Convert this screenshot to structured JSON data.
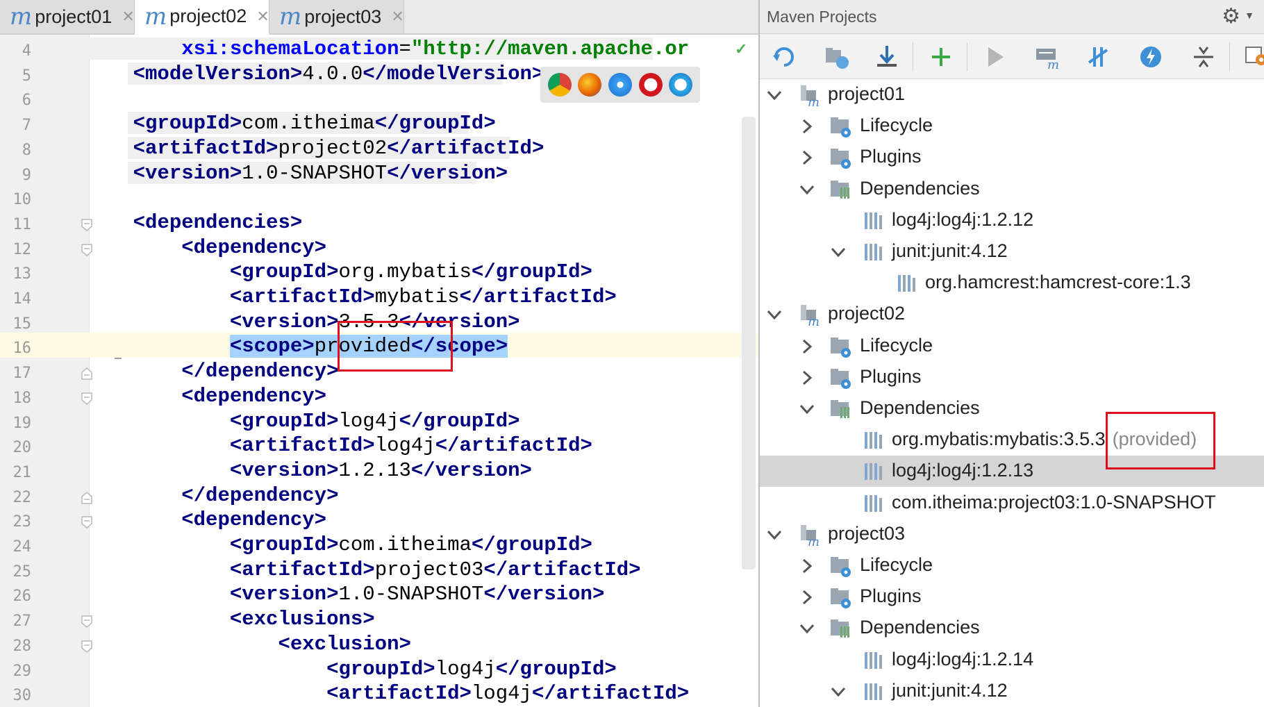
{
  "editor": {
    "tabs": [
      {
        "label": "project01",
        "active": false
      },
      {
        "label": "project02",
        "active": true
      },
      {
        "label": "project03",
        "active": false
      }
    ],
    "tab_icon": "maven-m-icon",
    "close_glyph": "✕",
    "lines": [
      {
        "n": "4",
        "text": "        xsi:schemaLocation=\"http://maven.apache.or"
      },
      {
        "n": "5",
        "text": "    <modelVersion>4.0.0</modelVersion>"
      },
      {
        "n": "6",
        "text": ""
      },
      {
        "n": "7",
        "text": "    <groupId>com.itheima</groupId>"
      },
      {
        "n": "8",
        "text": "    <artifactId>project02</artifactId>"
      },
      {
        "n": "9",
        "text": "    <version>1.0-SNAPSHOT</version>"
      },
      {
        "n": "10",
        "text": ""
      },
      {
        "n": "11",
        "text": "    <dependencies>"
      },
      {
        "n": "12",
        "text": "        <dependency>"
      },
      {
        "n": "13",
        "text": "            <groupId>org.mybatis</groupId>"
      },
      {
        "n": "14",
        "text": "            <artifactId>mybatis</artifactId>"
      },
      {
        "n": "15",
        "text": "            <version>3.5.3</version>"
      },
      {
        "n": "16",
        "text": "            <scope>provided</scope>"
      },
      {
        "n": "17",
        "text": "        </dependency>"
      },
      {
        "n": "18",
        "text": "        <dependency>"
      },
      {
        "n": "19",
        "text": "            <groupId>log4j</groupId>"
      },
      {
        "n": "20",
        "text": "            <artifactId>log4j</artifactId>"
      },
      {
        "n": "21",
        "text": "            <version>1.2.13</version>"
      },
      {
        "n": "22",
        "text": "        </dependency>"
      },
      {
        "n": "23",
        "text": "        <dependency>"
      },
      {
        "n": "24",
        "text": "            <groupId>com.itheima</groupId>"
      },
      {
        "n": "25",
        "text": "            <artifactId>project03</artifactId>"
      },
      {
        "n": "26",
        "text": "            <version>1.0-SNAPSHOT</version>"
      },
      {
        "n": "27",
        "text": "            <exclusions>"
      },
      {
        "n": "28",
        "text": "                <exclusion>"
      },
      {
        "n": "29",
        "text": "                    <groupId>log4j</groupId>"
      },
      {
        "n": "30",
        "text": "                    <artifactId>log4j</artifactId>"
      }
    ],
    "browser_icons": [
      "chrome-icon",
      "firefox-icon",
      "safari-icon",
      "opera-icon",
      "ie-icon"
    ],
    "intention_icon": "lightbulb-icon"
  },
  "maven": {
    "title": "Maven Projects",
    "settings_icon": "gear-icon",
    "toolbar_icons": [
      "reimport-icon",
      "generate-sources-icon",
      "download-icon",
      "add-icon",
      "run-icon",
      "execute-goal-icon",
      "toggle-offline-icon",
      "skip-tests-icon",
      "collapse-all-icon",
      "settings-icon"
    ],
    "tree": [
      {
        "label": "project01",
        "kind": "project",
        "level": 0,
        "expanded": true
      },
      {
        "label": "Lifecycle",
        "kind": "folder",
        "level": 1,
        "expanded": false
      },
      {
        "label": "Plugins",
        "kind": "folder",
        "level": 1,
        "expanded": false
      },
      {
        "label": "Dependencies",
        "kind": "deps",
        "level": 1,
        "expanded": true
      },
      {
        "label": "log4j:log4j:1.2.12",
        "kind": "lib",
        "level": 2,
        "expanded": null
      },
      {
        "label": "junit:junit:4.12",
        "kind": "lib",
        "level": 2,
        "expanded": true
      },
      {
        "label": "org.hamcrest:hamcrest-core:1.3",
        "kind": "lib",
        "level": 3,
        "expanded": null
      },
      {
        "label": "project02",
        "kind": "project",
        "level": 0,
        "expanded": true
      },
      {
        "label": "Lifecycle",
        "kind": "folder",
        "level": 1,
        "expanded": false
      },
      {
        "label": "Plugins",
        "kind": "folder",
        "level": 1,
        "expanded": false
      },
      {
        "label": "Dependencies",
        "kind": "deps",
        "level": 1,
        "expanded": true
      },
      {
        "label": "org.mybatis:mybatis:3.5.3",
        "note": "(provided)",
        "kind": "lib",
        "level": 2,
        "expanded": null
      },
      {
        "label": "log4j:log4j:1.2.13",
        "kind": "lib",
        "level": 2,
        "expanded": null,
        "selected": true
      },
      {
        "label": "com.itheima:project03:1.0-SNAPSHOT",
        "kind": "lib",
        "level": 2,
        "expanded": null
      },
      {
        "label": "project03",
        "kind": "project",
        "level": 0,
        "expanded": true
      },
      {
        "label": "Lifecycle",
        "kind": "folder",
        "level": 1,
        "expanded": false
      },
      {
        "label": "Plugins",
        "kind": "folder",
        "level": 1,
        "expanded": false
      },
      {
        "label": "Dependencies",
        "kind": "deps",
        "level": 1,
        "expanded": true
      },
      {
        "label": "log4j:log4j:1.2.14",
        "kind": "lib",
        "level": 2,
        "expanded": null
      },
      {
        "label": "junit:junit:4.12",
        "kind": "lib",
        "level": 2,
        "expanded": true
      }
    ]
  },
  "colors": {
    "tag": "#000080",
    "attr": "#0000ff",
    "string": "#008000",
    "selection": "#a6d2ff",
    "highlight_box": "#e0101a",
    "accent": "#3d8fd6"
  }
}
